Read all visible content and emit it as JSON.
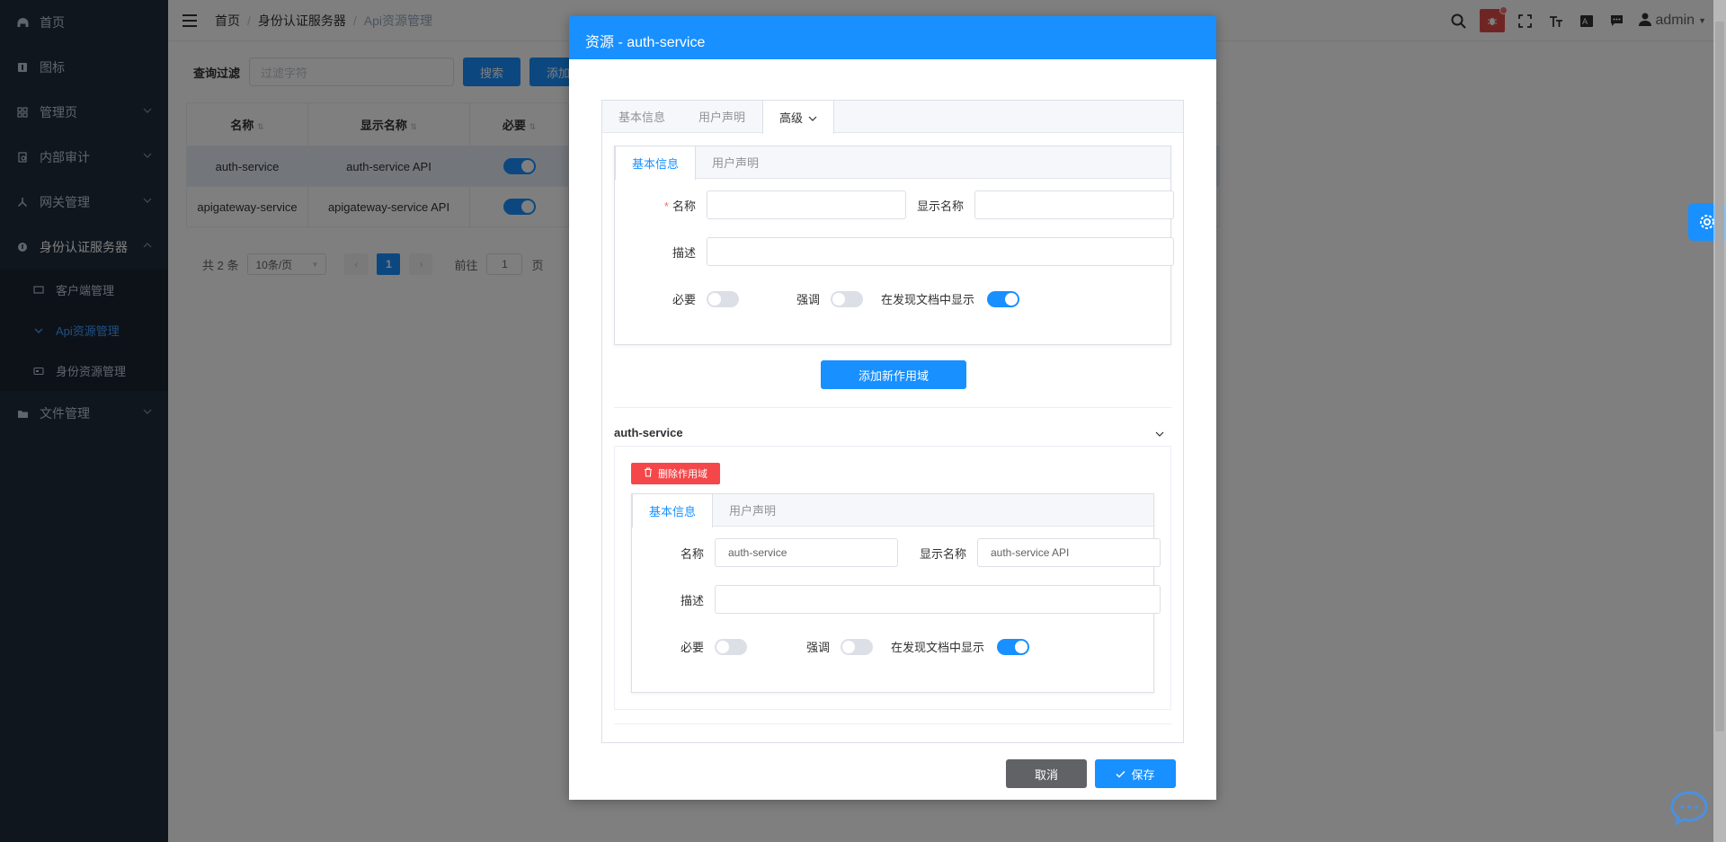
{
  "sidebar": {
    "items": [
      {
        "label": "首页",
        "icon": "dashboard-icon"
      },
      {
        "label": "图标",
        "icon": "info-icon"
      },
      {
        "label": "管理页",
        "icon": "grid-icon"
      },
      {
        "label": "内部审计",
        "icon": "audit-icon"
      },
      {
        "label": "网关管理",
        "icon": "gateway-icon"
      },
      {
        "label": "身份认证服务器",
        "icon": "identity-icon"
      }
    ],
    "sub_items": [
      {
        "label": "客户端管理"
      },
      {
        "label": "Api资源管理"
      },
      {
        "label": "身份资源管理"
      }
    ],
    "last_item": {
      "label": "文件管理"
    }
  },
  "breadcrumb": {
    "home": "首页",
    "parent": "身份认证服务器",
    "current": "Api资源管理"
  },
  "user": {
    "name": "admin"
  },
  "filter": {
    "label": "查询过滤",
    "placeholder": "过滤字符",
    "search": "搜索",
    "add": "添加资源"
  },
  "table": {
    "headers": [
      "名称",
      "显示名称",
      "必要"
    ],
    "rows": [
      {
        "name": "auth-service",
        "display": "auth-service API",
        "required": true
      },
      {
        "name": "apigateway-service",
        "display": "apigateway-service API",
        "required": true
      }
    ]
  },
  "pager": {
    "total": "共 2 条",
    "size": "10条/页",
    "page": "1",
    "goto": "前往",
    "goto_val": "1",
    "unit": "页"
  },
  "dialog": {
    "title": "资源 - auth-service",
    "outer_tabs": [
      "基本信息",
      "用户声明",
      "高级"
    ],
    "inner_tabs": [
      "基本信息",
      "用户声明"
    ],
    "new_scope": {
      "name_label": "名称",
      "display_label": "显示名称",
      "desc_label": "描述",
      "required_label": "必要",
      "emphasize_label": "强调",
      "discovery_label": "在发现文档中显示",
      "required": false,
      "emphasize": false,
      "discovery": true
    },
    "add_scope_button": "添加新作用域",
    "scope_section_title": "auth-service",
    "delete_scope_button": "删除作用域",
    "scope": {
      "name_label": "名称",
      "name_value": "auth-service",
      "display_label": "显示名称",
      "display_value": "auth-service API",
      "desc_label": "描述",
      "required_label": "必要",
      "emphasize_label": "强调",
      "discovery_label": "在发现文档中显示",
      "required": false,
      "emphasize": false,
      "discovery": true
    },
    "cancel": "取消",
    "save": "保存"
  }
}
